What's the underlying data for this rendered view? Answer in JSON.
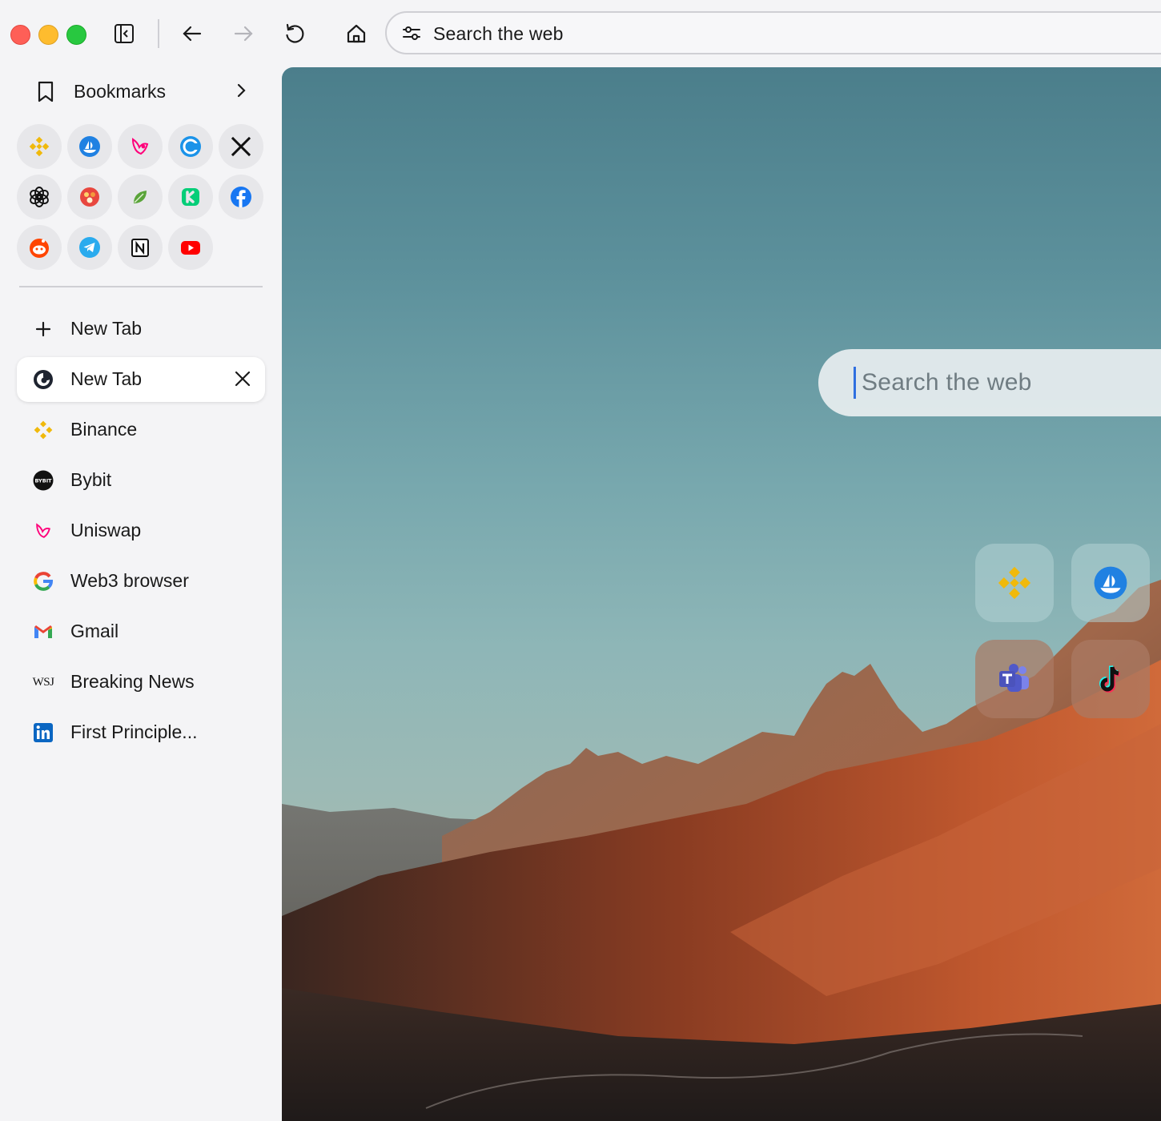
{
  "window": {
    "url_placeholder": "Search the web"
  },
  "sidebar": {
    "bookmarks_label": "Bookmarks",
    "favorites": [
      {
        "name": "binance",
        "icon": "binance-icon"
      },
      {
        "name": "opensea",
        "icon": "opensea-icon"
      },
      {
        "name": "uniswap",
        "icon": "uniswap-icon"
      },
      {
        "name": "coinmarketcap",
        "icon": "coinmarketcap-icon"
      },
      {
        "name": "x",
        "icon": "x-icon"
      },
      {
        "name": "chatgpt",
        "icon": "chatgpt-icon"
      },
      {
        "name": "pancake",
        "icon": "pancakeswap-icon"
      },
      {
        "name": "leaf",
        "icon": "leaf-icon"
      },
      {
        "name": "kickstarter",
        "icon": "kickstarter-icon"
      },
      {
        "name": "facebook",
        "icon": "facebook-icon"
      },
      {
        "name": "reddit",
        "icon": "reddit-icon"
      },
      {
        "name": "telegram",
        "icon": "telegram-icon"
      },
      {
        "name": "notion",
        "icon": "notion-icon"
      },
      {
        "name": "youtube",
        "icon": "youtube-icon"
      }
    ],
    "new_tab_label": "New Tab",
    "tabs": [
      {
        "label": "New Tab",
        "icon": "browser-logo-icon",
        "active": true
      },
      {
        "label": "Binance",
        "icon": "binance-icon"
      },
      {
        "label": "Bybit",
        "icon": "bybit-icon"
      },
      {
        "label": "Uniswap",
        "icon": "uniswap-icon"
      },
      {
        "label": "Web3 browser",
        "icon": "google-icon"
      },
      {
        "label": "Gmail",
        "icon": "gmail-icon"
      },
      {
        "label": "Breaking News",
        "icon": "wsj-icon"
      },
      {
        "label": "First Principle...",
        "icon": "linkedin-icon"
      }
    ],
    "wsj_text": "WSJ",
    "bybit_text": "BYBIT"
  },
  "content": {
    "search_placeholder": "Search the web",
    "quick_links": [
      {
        "name": "binance",
        "icon": "binance-icon"
      },
      {
        "name": "opensea",
        "icon": "opensea-icon"
      },
      {
        "name": "teams",
        "icon": "microsoft-teams-icon"
      },
      {
        "name": "tiktok",
        "icon": "tiktok-icon"
      }
    ]
  },
  "colors": {
    "accent": "#2f6fe0",
    "binance": "#f0b90b",
    "opensea": "#2081e2",
    "youtube": "#ff0000"
  }
}
